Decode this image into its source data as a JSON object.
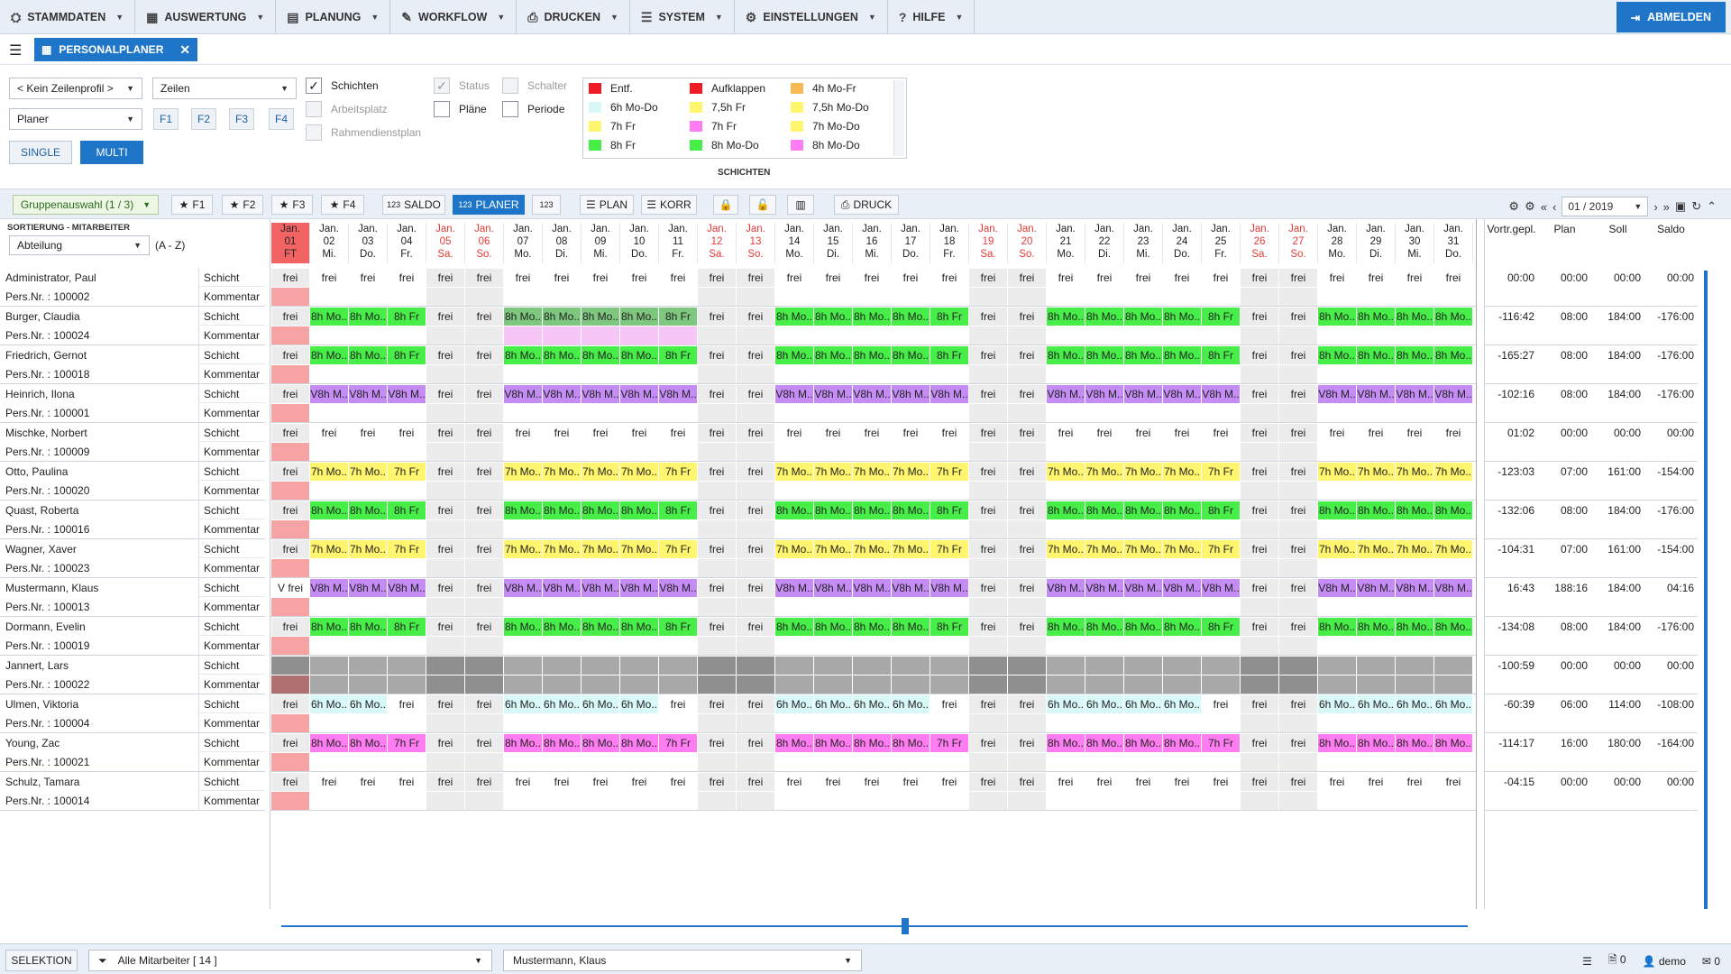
{
  "menu": {
    "items": [
      {
        "label": "STAMMDATEN",
        "icon": "⛭",
        "name": "stammdaten"
      },
      {
        "label": "AUSWERTUNG",
        "icon": "▦",
        "name": "auswertung"
      },
      {
        "label": "PLANUNG",
        "icon": "▤",
        "name": "planung"
      },
      {
        "label": "WORKFLOW",
        "icon": "✎",
        "name": "workflow"
      },
      {
        "label": "DRUCKEN",
        "icon": "⎙",
        "name": "drucken"
      },
      {
        "label": "SYSTEM",
        "icon": "☰",
        "name": "system"
      },
      {
        "label": "EINSTELLUNGEN",
        "icon": "⚙",
        "name": "einstellungen"
      },
      {
        "label": "HILFE",
        "icon": "?",
        "name": "hilfe"
      }
    ],
    "logout_label": "ABMELDEN"
  },
  "tab": {
    "label": "PERSONALPLANER"
  },
  "filters": {
    "zeilenprofil": "< Kein Zeilenprofil >",
    "zeilen": "Zeilen",
    "planer": "Planer",
    "f1": "F1",
    "f2": "F2",
    "f3": "F3",
    "f4": "F4",
    "single": "SINGLE",
    "multi": "MULTI",
    "cb_schichten": "Schichten",
    "cb_arbeitsplatz": "Arbeitsplatz",
    "cb_rahmen": "Rahmendienstplan",
    "cb_status": "Status",
    "cb_plaene": "Pläne",
    "cb_schalter": "Schalter",
    "cb_periode": "Periode"
  },
  "legend": {
    "title": "SCHICHTEN",
    "items": [
      {
        "label": "Entf.",
        "color": "#ee1c24"
      },
      {
        "label": "Aufklappen",
        "color": "#ee1c24"
      },
      {
        "label": "4h Mo-Fr",
        "color": "#f7b955"
      },
      {
        "label": "6h Mo-Do",
        "color": "#d9f8f8"
      },
      {
        "label": "7,5h Fr",
        "color": "#fff56e"
      },
      {
        "label": "7,5h Mo-Do",
        "color": "#fff56e"
      },
      {
        "label": "7h Fr",
        "color": "#fff56e"
      },
      {
        "label": "7h Fr",
        "color": "#ff7cf2"
      },
      {
        "label": "7h Mo-Do",
        "color": "#fff56e"
      },
      {
        "label": "8h Fr",
        "color": "#47ee47"
      },
      {
        "label": "8h Mo-Do",
        "color": "#47ee47"
      },
      {
        "label": "8h Mo-Do",
        "color": "#ff7cf2"
      }
    ]
  },
  "toolbar": {
    "gruppe": "Gruppenauswahl (1 / 3)",
    "f1": "F1",
    "f2": "F2",
    "f3": "F3",
    "f4": "F4",
    "saldo": "SALDO",
    "planer": "PLANER",
    "num": "123",
    "plan": "PLAN",
    "korr": "KORR",
    "druck": "DRUCK",
    "month": "01 / 2019"
  },
  "left": {
    "sort_header": "SORTIERUNG - MITARBEITER",
    "sort_value": "Abteilung",
    "sort_dir": "(A - Z)",
    "schicht": "Schicht",
    "kommentar": "Kommentar"
  },
  "days": [
    {
      "m": "Jan.",
      "d": "01",
      "w": "FT",
      "we": true,
      "today": true
    },
    {
      "m": "Jan.",
      "d": "02",
      "w": "Mi."
    },
    {
      "m": "Jan.",
      "d": "03",
      "w": "Do."
    },
    {
      "m": "Jan.",
      "d": "04",
      "w": "Fr."
    },
    {
      "m": "Jan.",
      "d": "05",
      "w": "Sa.",
      "we": true
    },
    {
      "m": "Jan.",
      "d": "06",
      "w": "So.",
      "we": true
    },
    {
      "m": "Jan.",
      "d": "07",
      "w": "Mo."
    },
    {
      "m": "Jan.",
      "d": "08",
      "w": "Di."
    },
    {
      "m": "Jan.",
      "d": "09",
      "w": "Mi."
    },
    {
      "m": "Jan.",
      "d": "10",
      "w": "Do."
    },
    {
      "m": "Jan.",
      "d": "11",
      "w": "Fr."
    },
    {
      "m": "Jan.",
      "d": "12",
      "w": "Sa.",
      "we": true
    },
    {
      "m": "Jan.",
      "d": "13",
      "w": "So.",
      "we": true
    },
    {
      "m": "Jan.",
      "d": "14",
      "w": "Mo."
    },
    {
      "m": "Jan.",
      "d": "15",
      "w": "Di."
    },
    {
      "m": "Jan.",
      "d": "16",
      "w": "Mi."
    },
    {
      "m": "Jan.",
      "d": "17",
      "w": "Do."
    },
    {
      "m": "Jan.",
      "d": "18",
      "w": "Fr."
    },
    {
      "m": "Jan.",
      "d": "19",
      "w": "Sa.",
      "we": true
    },
    {
      "m": "Jan.",
      "d": "20",
      "w": "So.",
      "we": true
    },
    {
      "m": "Jan.",
      "d": "21",
      "w": "Mo."
    },
    {
      "m": "Jan.",
      "d": "22",
      "w": "Di."
    },
    {
      "m": "Jan.",
      "d": "23",
      "w": "Mi."
    },
    {
      "m": "Jan.",
      "d": "24",
      "w": "Do."
    },
    {
      "m": "Jan.",
      "d": "25",
      "w": "Fr."
    },
    {
      "m": "Jan.",
      "d": "26",
      "w": "Sa.",
      "we": true
    },
    {
      "m": "Jan.",
      "d": "27",
      "w": "So.",
      "we": true
    },
    {
      "m": "Jan.",
      "d": "28",
      "w": "Mo."
    },
    {
      "m": "Jan.",
      "d": "29",
      "w": "Di."
    },
    {
      "m": "Jan.",
      "d": "30",
      "w": "Mi."
    },
    {
      "m": "Jan.",
      "d": "31",
      "w": "Do."
    }
  ],
  "summary_headers": [
    "Vortr.gepl.",
    "Plan",
    "Soll",
    "Saldo"
  ],
  "employees": [
    {
      "name": "Administrator, Paul",
      "pers": "Pers.Nr. : 100002",
      "pattern": "frei",
      "vortr": "00:00",
      "plan": "00:00",
      "soll": "00:00",
      "saldo": "00:00"
    },
    {
      "name": "Burger, Claudia",
      "pers": "Pers.Nr. : 100024",
      "pattern": "green",
      "hl": true,
      "vortr": "-116:42",
      "plan": "08:00",
      "soll": "184:00",
      "saldo": "-176:00"
    },
    {
      "name": "Friedrich, Gernot",
      "pers": "Pers.Nr. : 100018",
      "pattern": "green",
      "vortr": "-165:27",
      "plan": "08:00",
      "soll": "184:00",
      "saldo": "-176:00"
    },
    {
      "name": "Heinrich, Ilona",
      "pers": "Pers.Nr. : 100001",
      "pattern": "purple",
      "vortr": "-102:16",
      "plan": "08:00",
      "soll": "184:00",
      "saldo": "-176:00"
    },
    {
      "name": "Mischke, Norbert",
      "pers": "Pers.Nr. : 100009",
      "pattern": "frei",
      "vortr": "01:02",
      "plan": "00:00",
      "soll": "00:00",
      "saldo": "00:00"
    },
    {
      "name": "Otto, Paulina",
      "pers": "Pers.Nr. : 100020",
      "pattern": "yellow",
      "vortr": "-123:03",
      "plan": "07:00",
      "soll": "161:00",
      "saldo": "-154:00"
    },
    {
      "name": "Quast, Roberta",
      "pers": "Pers.Nr. : 100016",
      "pattern": "green",
      "vortr": "-132:06",
      "plan": "08:00",
      "soll": "184:00",
      "saldo": "-176:00"
    },
    {
      "name": "Wagner, Xaver",
      "pers": "Pers.Nr. : 100023",
      "pattern": "yellow",
      "vortr": "-104:31",
      "plan": "07:00",
      "soll": "161:00",
      "saldo": "-154:00"
    },
    {
      "name": "Mustermann, Klaus",
      "pers": "Pers.Nr. : 100013",
      "pattern": "purple",
      "first": "V frei",
      "vortr": "16:43",
      "plan": "188:16",
      "soll": "184:00",
      "saldo": "04:16"
    },
    {
      "name": "Dormann, Evelin",
      "pers": "Pers.Nr. : 100019",
      "pattern": "green",
      "vortr": "-134:08",
      "plan": "08:00",
      "soll": "184:00",
      "saldo": "-176:00"
    },
    {
      "name": "Jannert, Lars",
      "pers": "Pers.Nr. : 100022",
      "pattern": "gray",
      "vortr": "-100:59",
      "plan": "00:00",
      "soll": "00:00",
      "saldo": "00:00"
    },
    {
      "name": "Ulmen, Viktoria",
      "pers": "Pers.Nr. : 100004",
      "pattern": "cyan",
      "vortr": "-60:39",
      "plan": "06:00",
      "soll": "114:00",
      "saldo": "-108:00"
    },
    {
      "name": "Young, Zac",
      "pers": "Pers.Nr. : 100021",
      "pattern": "pink",
      "vortr": "-114:17",
      "plan": "16:00",
      "soll": "180:00",
      "saldo": "-164:00"
    },
    {
      "name": "Schulz, Tamara",
      "pers": "Pers.Nr. : 100014",
      "pattern": "frei",
      "vortr": "-04:15",
      "plan": "00:00",
      "soll": "00:00",
      "saldo": "00:00"
    }
  ],
  "patterns": {
    "green": {
      "mo": "8h Mo..",
      "fr": "8h Fr",
      "color": "#47ee47"
    },
    "purple": {
      "mo": "V8h M..",
      "fr": "V8h M..",
      "color": "#c58cf5"
    },
    "yellow": {
      "mo": "7h Mo..",
      "fr": "7h Fr",
      "color": "#fff56e"
    },
    "cyan": {
      "mo": "6h Mo..",
      "fr": "frei",
      "color": "#d9f8f8"
    },
    "pink": {
      "mo": "8h Mo..",
      "fr": "7h Fr",
      "color": "#ff7cf2"
    }
  },
  "frei": "frei",
  "status": {
    "selektion": "SELEKTION",
    "filter": "Alle Mitarbeiter  [ 14 ]",
    "person": "Mustermann, Klaus",
    "docs": "0",
    "user": "demo",
    "mail": "0"
  }
}
